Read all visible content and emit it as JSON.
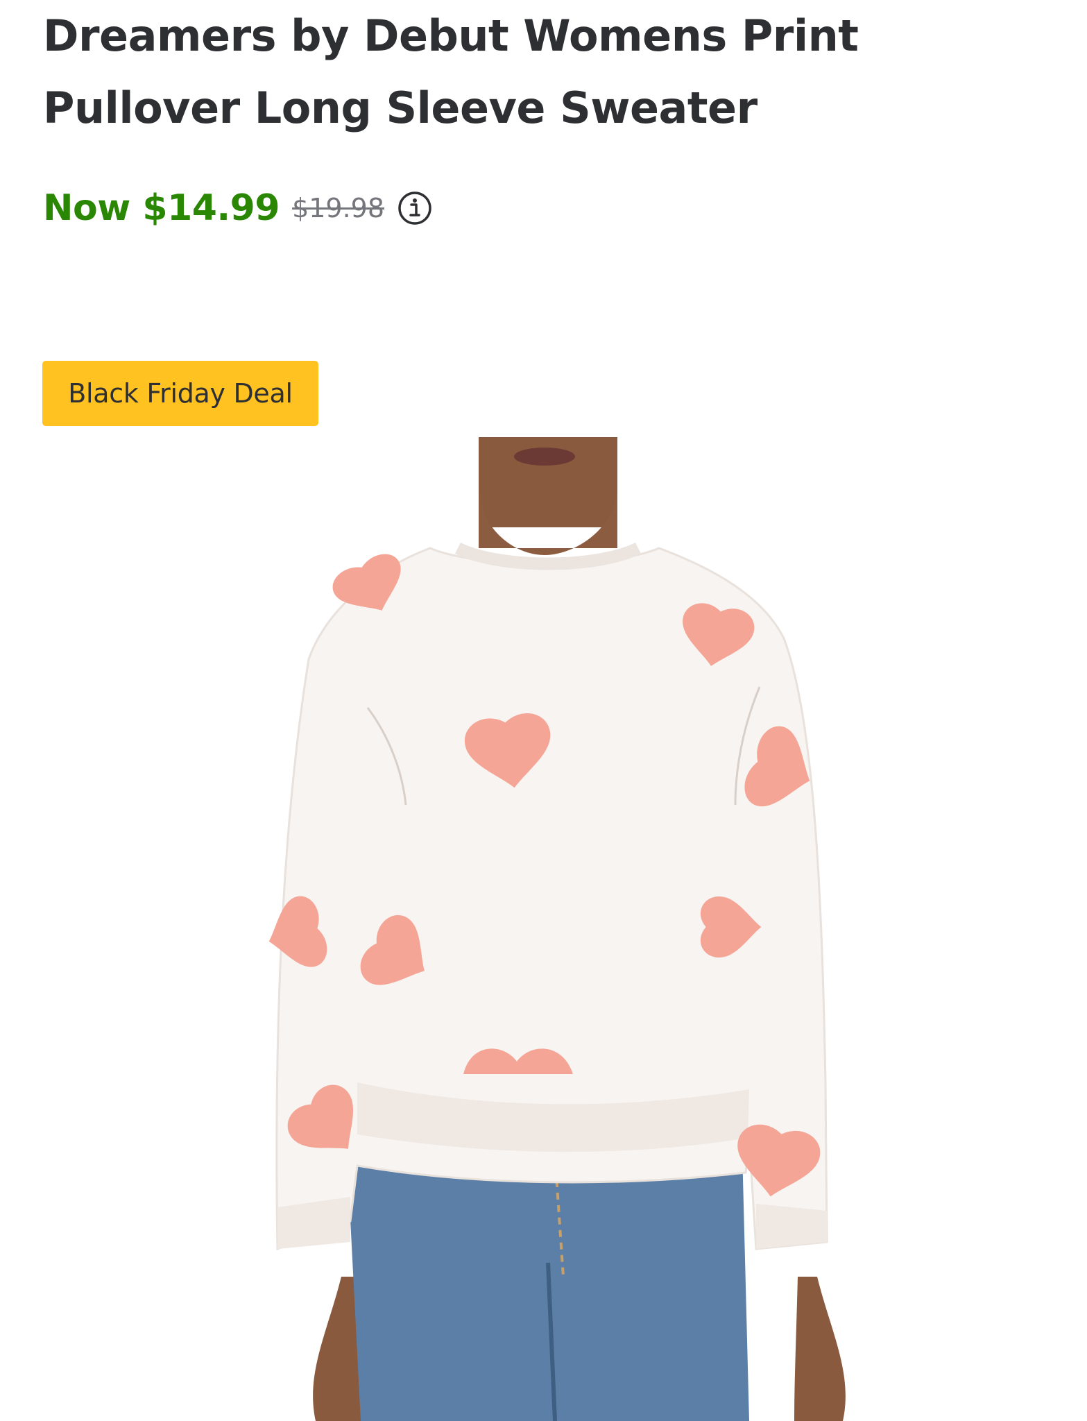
{
  "product": {
    "title": "Dreamers by Debut Womens Print Pullover Long Sleeve Sweater",
    "now_price": "Now $14.99",
    "was_price": "$19.98",
    "info_icon": "info-icon",
    "deal_badge": "Black Friday Deal"
  },
  "colors": {
    "price_green": "#2a8703",
    "badge_yellow": "#ffc220",
    "text_dark": "#2e2f32",
    "text_gray": "#74767c",
    "heart_pink": "#f4a596"
  },
  "image": {
    "alt": "Dreamers by Debut Womens Print Pullover Long Sleeve Sweater"
  }
}
